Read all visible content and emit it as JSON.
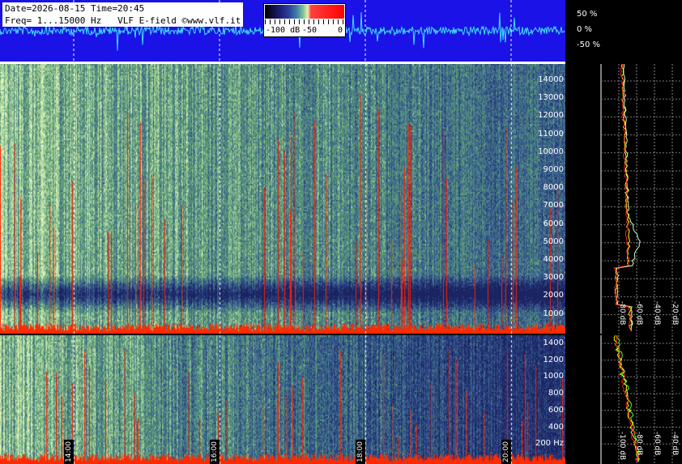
{
  "header": {
    "line1": "Date=2026-08-15 Time=20:45",
    "line2": "Freq= 1...15000 Hz   VLF E-field ©www.vlf.it"
  },
  "colorbar": {
    "label_low": "-100 dB",
    "label_mid": "-50",
    "label_high": "0"
  },
  "amplitude_scale": {
    "top": "50 %",
    "mid": "0 %",
    "bottom": "-50 %"
  },
  "upper_freq_axis": [
    "14000",
    "13000",
    "12000",
    "11000",
    "10000",
    "9000",
    "8000",
    "7000",
    "6000",
    "5000",
    "4000",
    "3000",
    "2000",
    "1000"
  ],
  "lower_freq_axis": [
    "1400",
    "1200",
    "1000",
    "800",
    "600",
    "400",
    "200 Hz"
  ],
  "db_axis": [
    "-100 dB",
    "-80 dB",
    "-60 dB",
    "-40 dB",
    "-20 dB"
  ],
  "time_labels": [
    "14:00",
    "16:00",
    "18:00",
    "20:00"
  ],
  "colors": {
    "wave_bg": "#1a12e6",
    "wave_trace": "#40e0ff",
    "spec_dark": "#1d2a66",
    "spec_mid": "#5e9a78",
    "spec_light": "#d8ecb0",
    "spec_hot": "#ff2000"
  }
}
